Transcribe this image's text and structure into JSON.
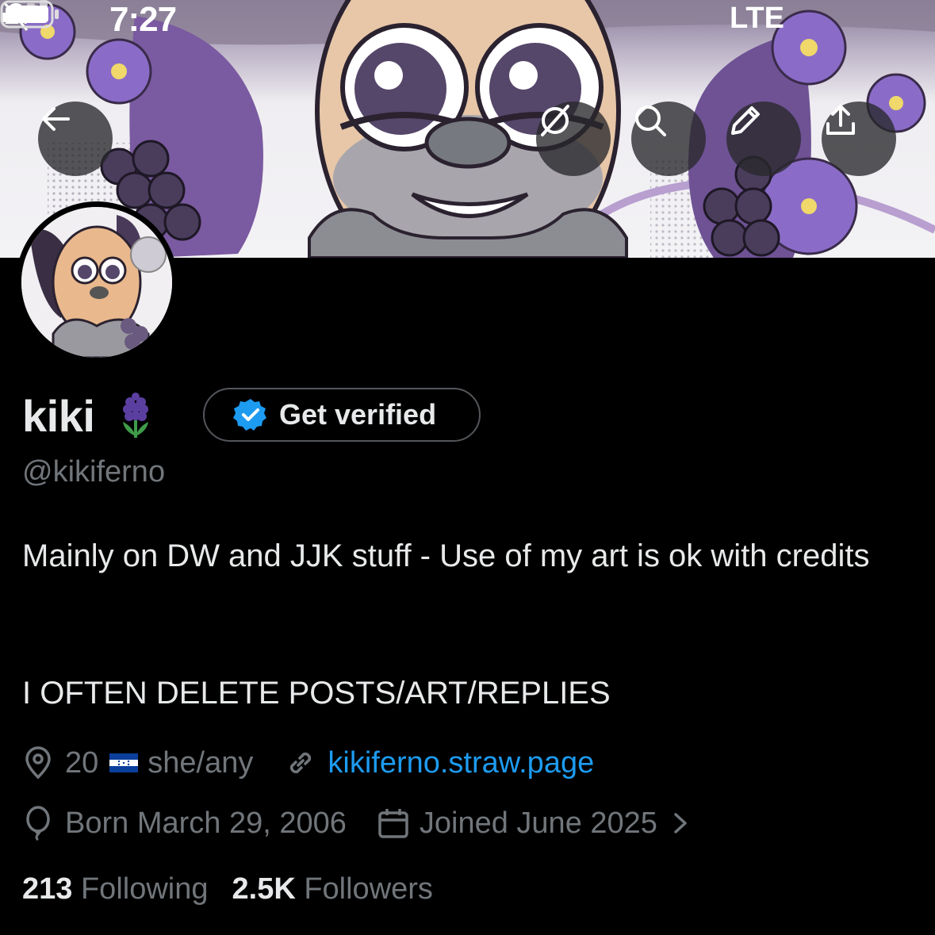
{
  "status_bar": {
    "time": "7:27",
    "network": "LTE",
    "icons": [
      "bell-muted-icon",
      "signal-icon",
      "battery-icon"
    ]
  },
  "header": {
    "buttons": [
      {
        "name": "back-button",
        "icon": "arrow-left-icon"
      },
      {
        "name": "grok-button",
        "icon": "slashed-circle-icon"
      },
      {
        "name": "search-button",
        "icon": "search-icon"
      },
      {
        "name": "edit-button",
        "icon": "pencil-icon"
      },
      {
        "name": "share-button",
        "icon": "share-icon"
      }
    ]
  },
  "profile": {
    "display_name": "kiki",
    "name_emoji": "hyacinth-icon",
    "verify_label": "Get verified",
    "handle": "@kikiferno",
    "bio": "Mainly on DW and JJK stuff - Use of my art is ok with credits",
    "bio_line2": "I OFTEN DELETE POSTS/ART/REPLIES",
    "location": "20 🇭🇳 she/any",
    "location_age": "20",
    "location_pronouns": "she/any",
    "website": "kikiferno.straw.page",
    "birthday": "Born March 29, 2006",
    "joined": "Joined June 2025",
    "following_count": "213",
    "following_label": "Following",
    "followers_count": "2.5K",
    "followers_label": "Followers"
  },
  "colors": {
    "background": "#000000",
    "text": "#e7e9ea",
    "muted": "#71767b",
    "link": "#1d9bf0",
    "verified_blue": "#1d9bf0",
    "banner_purple": "#8b6bb3"
  }
}
